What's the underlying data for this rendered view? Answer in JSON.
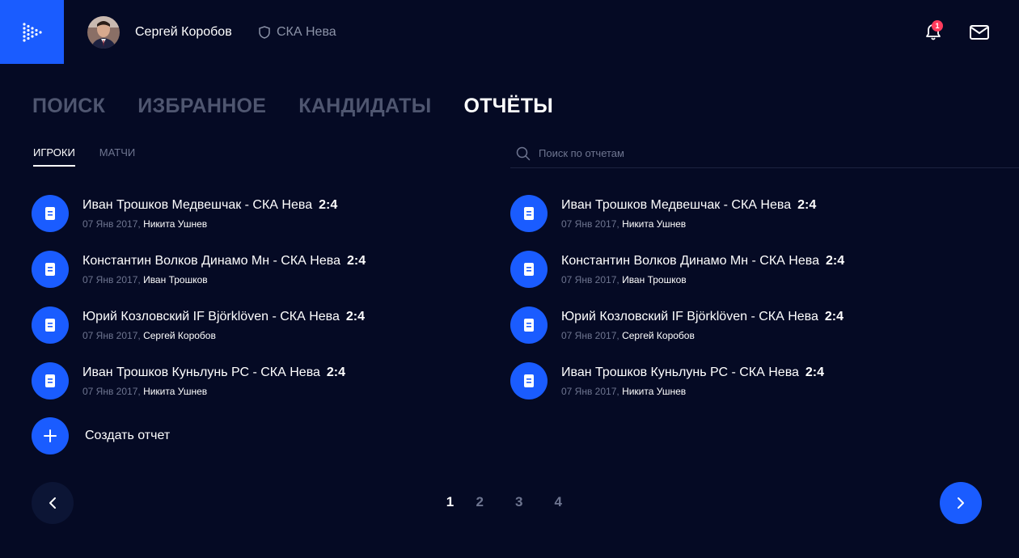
{
  "header": {
    "user_name": "Сергей Коробов",
    "team_name": "СКА Нева",
    "notification_count": "1"
  },
  "main_tabs": [
    {
      "label": "ПОИСК",
      "active": false
    },
    {
      "label": "ИЗБРАННОЕ",
      "active": false
    },
    {
      "label": "КАНДИДАТЫ",
      "active": false
    },
    {
      "label": "ОТЧЁТЫ",
      "active": true
    }
  ],
  "sub_tabs": [
    {
      "label": "ИГРОКИ",
      "active": true
    },
    {
      "label": "МАТЧИ",
      "active": false
    }
  ],
  "search": {
    "placeholder": "Поиск по отчетам"
  },
  "left_reports": [
    {
      "title": "Иван Трошков Медвешчак - СКА Нева",
      "score": "2:4",
      "date": "07 Янв 2017,",
      "author": "Никита Ушнев"
    },
    {
      "title": "Константин Волков Динамо Мн - СКА Нева",
      "score": "2:4",
      "date": "07 Янв 2017,",
      "author": "Иван Трошков"
    },
    {
      "title": "Юрий Козловский IF Björklöven - СКА Нева",
      "score": "2:4",
      "date": "07 Янв 2017,",
      "author": "Сергей Коробов"
    },
    {
      "title": "Иван Трошков Куньлунь РС - СКА Нева",
      "score": "2:4",
      "date": "07 Янв 2017,",
      "author": "Никита Ушнев"
    }
  ],
  "right_reports": [
    {
      "title": "Иван Трошков Медвешчак - СКА Нева",
      "score": "2:4",
      "date": "07 Янв 2017,",
      "author": "Никита Ушнев"
    },
    {
      "title": "Константин Волков Динамо Мн - СКА Нева",
      "score": "2:4",
      "date": "07 Янв 2017,",
      "author": "Иван Трошков"
    },
    {
      "title": "Юрий Козловский IF Björklöven - СКА Нева",
      "score": "2:4",
      "date": "07 Янв 2017,",
      "author": "Сергей Коробов"
    },
    {
      "title": "Иван Трошков Куньлунь РС - СКА Нева",
      "score": "2:4",
      "date": "07 Янв 2017,",
      "author": "Никита Ушнев"
    }
  ],
  "create_label": "Создать отчет",
  "pagination": {
    "pages": [
      "1",
      "2",
      "3",
      "4"
    ],
    "current": "1"
  },
  "colors": {
    "background": "#050a24",
    "accent": "#1a5cff",
    "muted_text": "#6e7590",
    "badge": "#ff3b5c"
  },
  "icons": {
    "logo": "play-logo-icon",
    "team": "shield-icon",
    "notifications": "bell-icon",
    "messages": "mail-icon",
    "search": "search-icon",
    "report": "document-icon",
    "create": "plus-icon",
    "prev": "chevron-left-icon",
    "next": "chevron-right-icon"
  }
}
